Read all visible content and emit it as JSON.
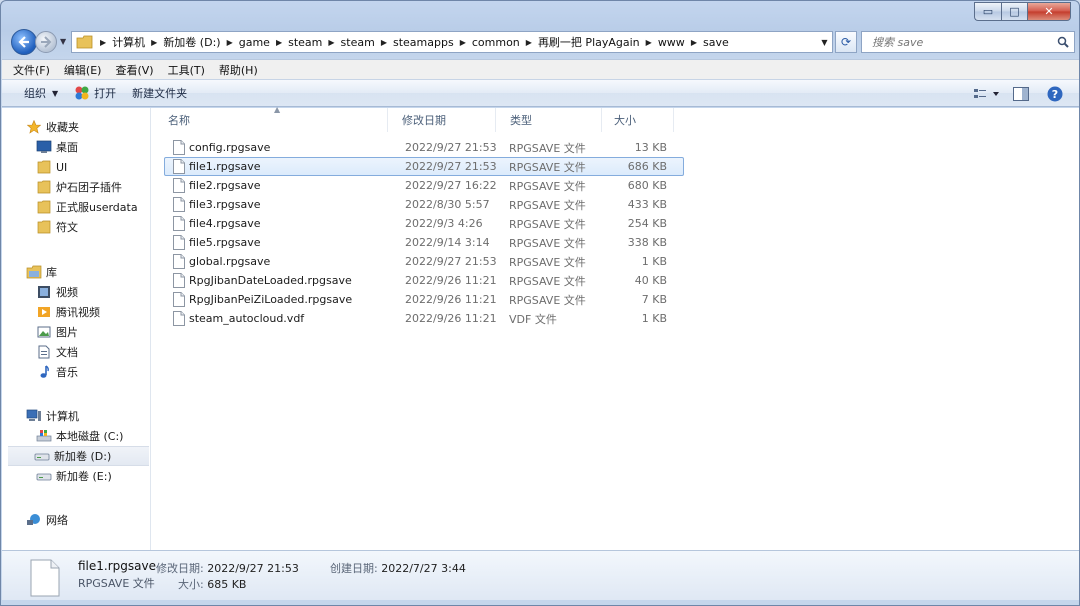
{
  "window": {
    "min_glyph": "▭",
    "max_glyph": "□",
    "close_glyph": "✕"
  },
  "address": {
    "crumbs": [
      "计算机",
      "新加卷 (D:)",
      "game",
      "steam",
      "steam",
      "steamapps",
      "common",
      "再刷一把 PlayAgain",
      "www",
      "save"
    ]
  },
  "search": {
    "placeholder": "搜索 save"
  },
  "menu": [
    "文件(F)",
    "编辑(E)",
    "查看(V)",
    "工具(T)",
    "帮助(H)"
  ],
  "toolbar": {
    "organize": "组织",
    "open": "打开",
    "new_folder": "新建文件夹"
  },
  "nav": {
    "favorites": {
      "label": "收藏夹",
      "items": [
        "桌面",
        "UI",
        "炉石团子插件",
        "正式服userdata",
        "符文"
      ]
    },
    "libraries": {
      "label": "库",
      "items": [
        "视频",
        "腾讯视频",
        "图片",
        "文档",
        "音乐"
      ]
    },
    "computer": {
      "label": "计算机",
      "items": [
        "本地磁盘 (C:)",
        "新加卷 (D:)",
        "新加卷 (E:)"
      ]
    },
    "network": {
      "label": "网络"
    }
  },
  "columns": {
    "name": "名称",
    "date": "修改日期",
    "type": "类型",
    "size": "大小"
  },
  "files": [
    {
      "name": "config.rpgsave",
      "date": "2022/9/27 21:53",
      "type": "RPGSAVE 文件",
      "size": "13 KB"
    },
    {
      "name": "file1.rpgsave",
      "date": "2022/9/27 21:53",
      "type": "RPGSAVE 文件",
      "size": "686 KB"
    },
    {
      "name": "file2.rpgsave",
      "date": "2022/9/27 16:22",
      "type": "RPGSAVE 文件",
      "size": "680 KB"
    },
    {
      "name": "file3.rpgsave",
      "date": "2022/8/30 5:57",
      "type": "RPGSAVE 文件",
      "size": "433 KB"
    },
    {
      "name": "file4.rpgsave",
      "date": "2022/9/3 4:26",
      "type": "RPGSAVE 文件",
      "size": "254 KB"
    },
    {
      "name": "file5.rpgsave",
      "date": "2022/9/14 3:14",
      "type": "RPGSAVE 文件",
      "size": "338 KB"
    },
    {
      "name": "global.rpgsave",
      "date": "2022/9/27 21:53",
      "type": "RPGSAVE 文件",
      "size": "1 KB"
    },
    {
      "name": "RpgJibanDateLoaded.rpgsave",
      "date": "2022/9/26 11:21",
      "type": "RPGSAVE 文件",
      "size": "40 KB"
    },
    {
      "name": "RpgJibanPeiZiLoaded.rpgsave",
      "date": "2022/9/26 11:21",
      "type": "RPGSAVE 文件",
      "size": "7 KB"
    },
    {
      "name": "steam_autocloud.vdf",
      "date": "2022/9/26 11:21",
      "type": "VDF 文件",
      "size": "1 KB"
    }
  ],
  "selected_file_index": 1,
  "selected_nav_item": "新加卷 (D:)",
  "details": {
    "name": "file1.rpgsave",
    "type": "RPGSAVE 文件",
    "modified_label": "修改日期:",
    "modified_value": "2022/9/27 21:53",
    "created_label": "创建日期:",
    "created_value": "2022/7/27 3:44",
    "size_label": "大小:",
    "size_value": "685 KB"
  },
  "colors": {
    "accent": "#1f5fbd",
    "selection_border": "#84acdd",
    "selection_fill": "#dcebfc",
    "folder": "#e8c25a"
  }
}
